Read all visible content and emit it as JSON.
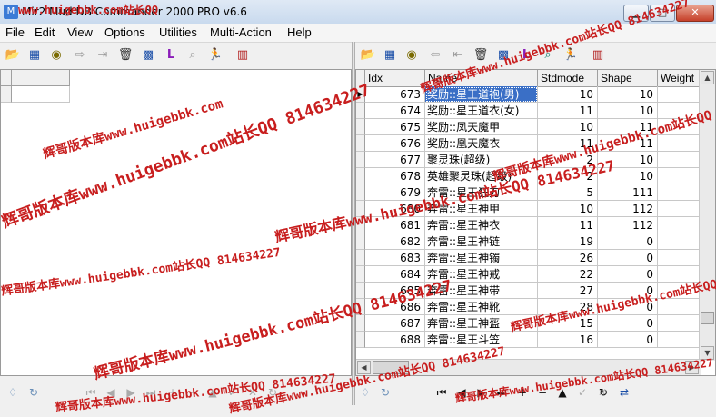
{
  "window": {
    "title": "Mir2 Mud DB Commander 2000 PRO v6.6",
    "minimize_glyph": "▁",
    "maximize_glyph": "□",
    "close_glyph": "✕"
  },
  "menu": [
    "File",
    "Edit",
    "View",
    "Options",
    "Utilities",
    "Multi-Action",
    "Help"
  ],
  "toolbar_icons": [
    "open-folder-icon",
    "table-icon",
    "binoculars-icon",
    "arrow-right-icon",
    "export-icon",
    "trash-icon",
    "grid-icon",
    "L-icon",
    "magnifier-icon",
    "runner-icon",
    "book-icon"
  ],
  "grid": {
    "columns": [
      "Idx",
      "Name",
      "Stdmode",
      "Shape",
      "Weight"
    ],
    "rows": [
      {
        "idx": "673",
        "name": "奖励::星王道袍(男)",
        "stdmode": "10",
        "shape": "10",
        "selected": true
      },
      {
        "idx": "674",
        "name": "奖励::星王道衣(女)",
        "stdmode": "11",
        "shape": "10"
      },
      {
        "idx": "675",
        "name": "奖励::凤天魔甲",
        "stdmode": "10",
        "shape": "11"
      },
      {
        "idx": "676",
        "name": "奖励::凰天魔衣",
        "stdmode": "11",
        "shape": "11"
      },
      {
        "idx": "677",
        "name": "聚灵珠(超级)",
        "stdmode": "2",
        "shape": "10"
      },
      {
        "idx": "678",
        "name": "英雄聚灵珠(超级)",
        "stdmode": "2",
        "shape": "10"
      },
      {
        "idx": "679",
        "name": "奔雷::星王狂刀",
        "stdmode": "5",
        "shape": "111"
      },
      {
        "idx": "680",
        "name": "奔雷::星王神甲",
        "stdmode": "10",
        "shape": "112"
      },
      {
        "idx": "681",
        "name": "奔雷::星王神衣",
        "stdmode": "11",
        "shape": "112"
      },
      {
        "idx": "682",
        "name": "奔雷::星王神链",
        "stdmode": "19",
        "shape": "0"
      },
      {
        "idx": "683",
        "name": "奔雷::星王神镯",
        "stdmode": "26",
        "shape": "0"
      },
      {
        "idx": "684",
        "name": "奔雷::星王神戒",
        "stdmode": "22",
        "shape": "0"
      },
      {
        "idx": "685",
        "name": "奔雷::星王神带",
        "stdmode": "27",
        "shape": "0"
      },
      {
        "idx": "686",
        "name": "奔雷::星王神靴",
        "stdmode": "28",
        "shape": "0"
      },
      {
        "idx": "687",
        "name": "奔雷::星王神盔",
        "stdmode": "15",
        "shape": "0"
      },
      {
        "idx": "688",
        "name": "奔雷::星王斗笠",
        "stdmode": "16",
        "shape": "0"
      }
    ]
  },
  "watermarks": [
    "www.huigebbk.com站长QQ",
    "辉哥版本库www.huigebbk.com",
    "辉哥版本库www.huigebbk.com站长QQ 814634227",
    "辉哥版本库www.huigebbk.com站长QQ 814634227",
    "辉哥版本库www.huigebbk.com站长QQ 814634227",
    "辉哥版本库www.huigebbk.com站长QQ 814634227",
    "辉哥版本库www.huigebbk.com站长QQ 814634227",
    "辉哥版本库www.huigebbk.com站长QQ 814634227",
    "辉哥版本库www.huigebbk.com站长QQ 814634227",
    "辉哥版本库www.huigebbk.com站长QQ 814634227",
    "辉哥版本库www.huigebbk.com站长QQ 814634227",
    "辉哥版本库www.huigebbk.com站长QQ 814634227"
  ],
  "nav_buttons": [
    "first-record-icon",
    "prior-record-icon",
    "next-record-icon",
    "last-record-icon",
    "insert-record-icon",
    "delete-record-icon",
    "edit-record-icon",
    "post-record-icon",
    "cancel-record-icon",
    "refresh-record-icon",
    "apply-updates-icon"
  ]
}
